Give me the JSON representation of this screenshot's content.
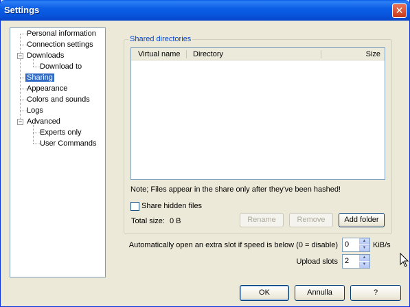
{
  "window": {
    "title": "Settings",
    "close_glyph": "✕"
  },
  "tree": {
    "items": [
      {
        "label": "Personal information"
      },
      {
        "label": "Connection settings"
      },
      {
        "label": "Downloads",
        "expander": "−"
      },
      {
        "label": "Download to"
      },
      {
        "label": "Sharing",
        "selected": true
      },
      {
        "label": "Appearance"
      },
      {
        "label": "Colors and sounds"
      },
      {
        "label": "Logs"
      },
      {
        "label": "Advanced",
        "expander": "−"
      },
      {
        "label": "Experts only"
      },
      {
        "label": "User Commands"
      }
    ]
  },
  "shared": {
    "group_title": "Shared directories",
    "columns": [
      "Virtual name",
      "Directory",
      "Size"
    ],
    "note": "Note; Files appear in the share only after they've been hashed!",
    "hidden_label": "Share hidden files",
    "hidden_checked": false,
    "total_label": "Total size:",
    "total_value": "0 B",
    "rename": "Rename",
    "remove": "Remove",
    "add_folder": "Add folder"
  },
  "slots": {
    "extra_label": "Automatically open an extra slot if speed is below (0 = disable)",
    "extra_value": "0",
    "extra_unit": "KiB/s",
    "upload_label": "Upload slots",
    "upload_value": "2"
  },
  "footer": {
    "ok": "OK",
    "cancel": "Annulla",
    "help": "?"
  },
  "colors": {
    "title_bar": "#0a5ee8",
    "selection": "#316ac5",
    "group_title": "#0046d5",
    "dialog_bg": "#ece9d8"
  }
}
